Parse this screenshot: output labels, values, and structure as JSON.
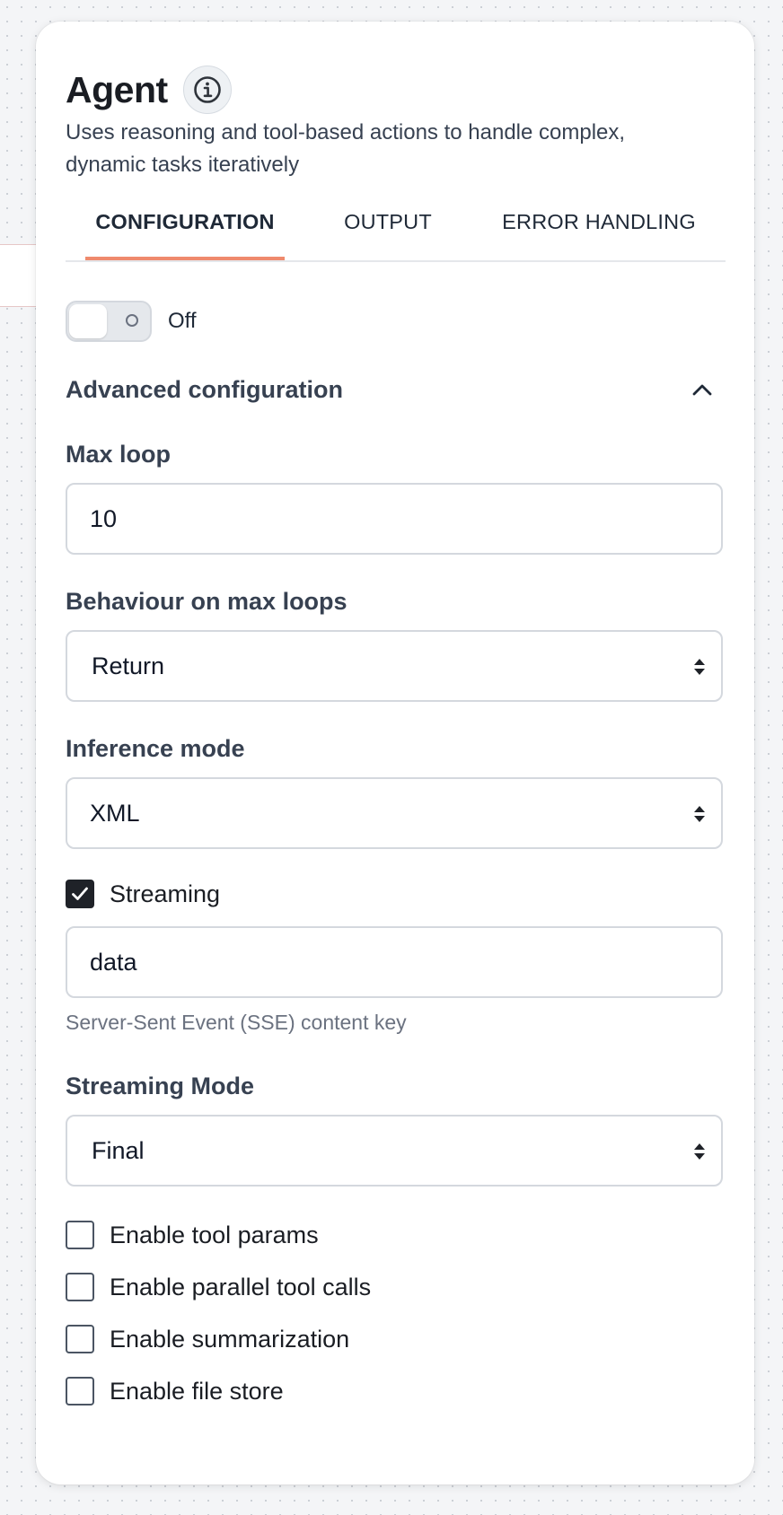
{
  "panel": {
    "title": "Agent",
    "subtitle": "Uses reasoning and tool-based actions to handle complex, dynamic tasks iteratively"
  },
  "tabs": [
    {
      "label": "CONFIGURATION",
      "active": true
    },
    {
      "label": "OUTPUT",
      "active": false
    },
    {
      "label": "ERROR HANDLING",
      "active": false
    }
  ],
  "toggle": {
    "state_label": "Off",
    "enabled": false
  },
  "advanced": {
    "title": "Advanced configuration",
    "expanded": true,
    "max_loop": {
      "label": "Max loop",
      "value": "10"
    },
    "behaviour": {
      "label": "Behaviour on max loops",
      "value": "Return"
    },
    "inference": {
      "label": "Inference mode",
      "value": "XML"
    },
    "streaming": {
      "label": "Streaming",
      "checked": true,
      "key_value": "data",
      "helper": "Server-Sent Event (SSE) content key"
    },
    "streaming_mode": {
      "label": "Streaming Mode",
      "value": "Final"
    },
    "options": [
      {
        "label": "Enable tool params",
        "checked": false
      },
      {
        "label": "Enable parallel tool calls",
        "checked": false
      },
      {
        "label": "Enable summarization",
        "checked": false
      },
      {
        "label": "Enable file store",
        "checked": false
      }
    ]
  },
  "colors": {
    "tab_underline": "#ef8a6d",
    "checkbox_checked": "#1f2228",
    "border": "#d4d8de"
  },
  "icons": {
    "info": "info-icon",
    "collapse": "chevron-up-icon",
    "select": "updown-icon",
    "check": "check-icon",
    "toggle_off": "circle-icon"
  }
}
